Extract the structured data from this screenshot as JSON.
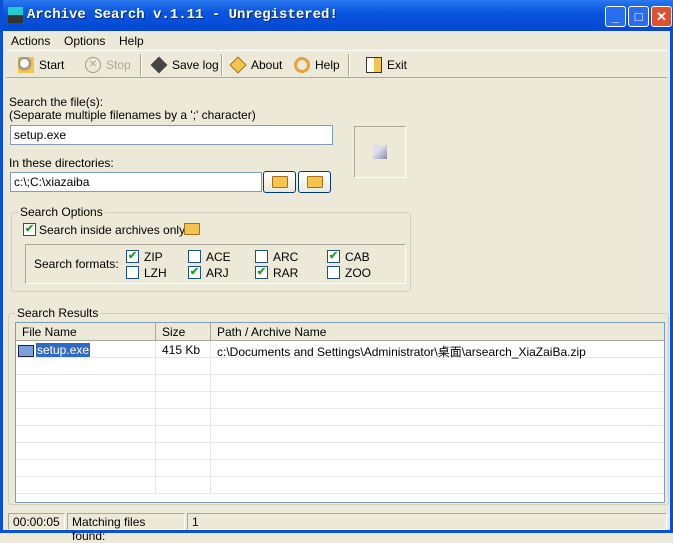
{
  "window": {
    "title": "Archive Search v.1.11 - Unregistered!"
  },
  "menu": [
    "Actions",
    "Options",
    "Help"
  ],
  "toolbar": {
    "start": "Start",
    "stop": "Stop",
    "save_log": "Save log",
    "about": "About",
    "help": "Help",
    "exit": "Exit"
  },
  "search": {
    "files_label": "Search the file(s):",
    "files_hint": "(Separate multiple filenames by a ';' character)",
    "files_value": "setup.exe",
    "dirs_label": "In these directories:",
    "dirs_value": "c:\\;C:\\xiazaiba"
  },
  "options": {
    "title": "Search Options",
    "inside_archives_label": "Search inside archives only",
    "inside_archives_checked": true,
    "formats_label": "Search formats:",
    "formats": [
      {
        "name": "ZIP",
        "checked": true
      },
      {
        "name": "ACE",
        "checked": false
      },
      {
        "name": "ARC",
        "checked": false
      },
      {
        "name": "CAB",
        "checked": true
      },
      {
        "name": "LZH",
        "checked": false
      },
      {
        "name": "ARJ",
        "checked": true
      },
      {
        "name": "RAR",
        "checked": true
      },
      {
        "name": "ZOO",
        "checked": false
      }
    ]
  },
  "results": {
    "title": "Search Results",
    "columns": [
      "File Name",
      "Size",
      "Path / Archive Name"
    ],
    "rows": [
      {
        "name": "setup.exe",
        "size": "415 Kb",
        "path": "c:\\Documents and Settings\\Administrator\\桌面\\arsearch_XiaZaiBa.zip"
      }
    ]
  },
  "status": {
    "time": "00:00:05",
    "matching_label": "Matching files found:",
    "count": "1"
  }
}
